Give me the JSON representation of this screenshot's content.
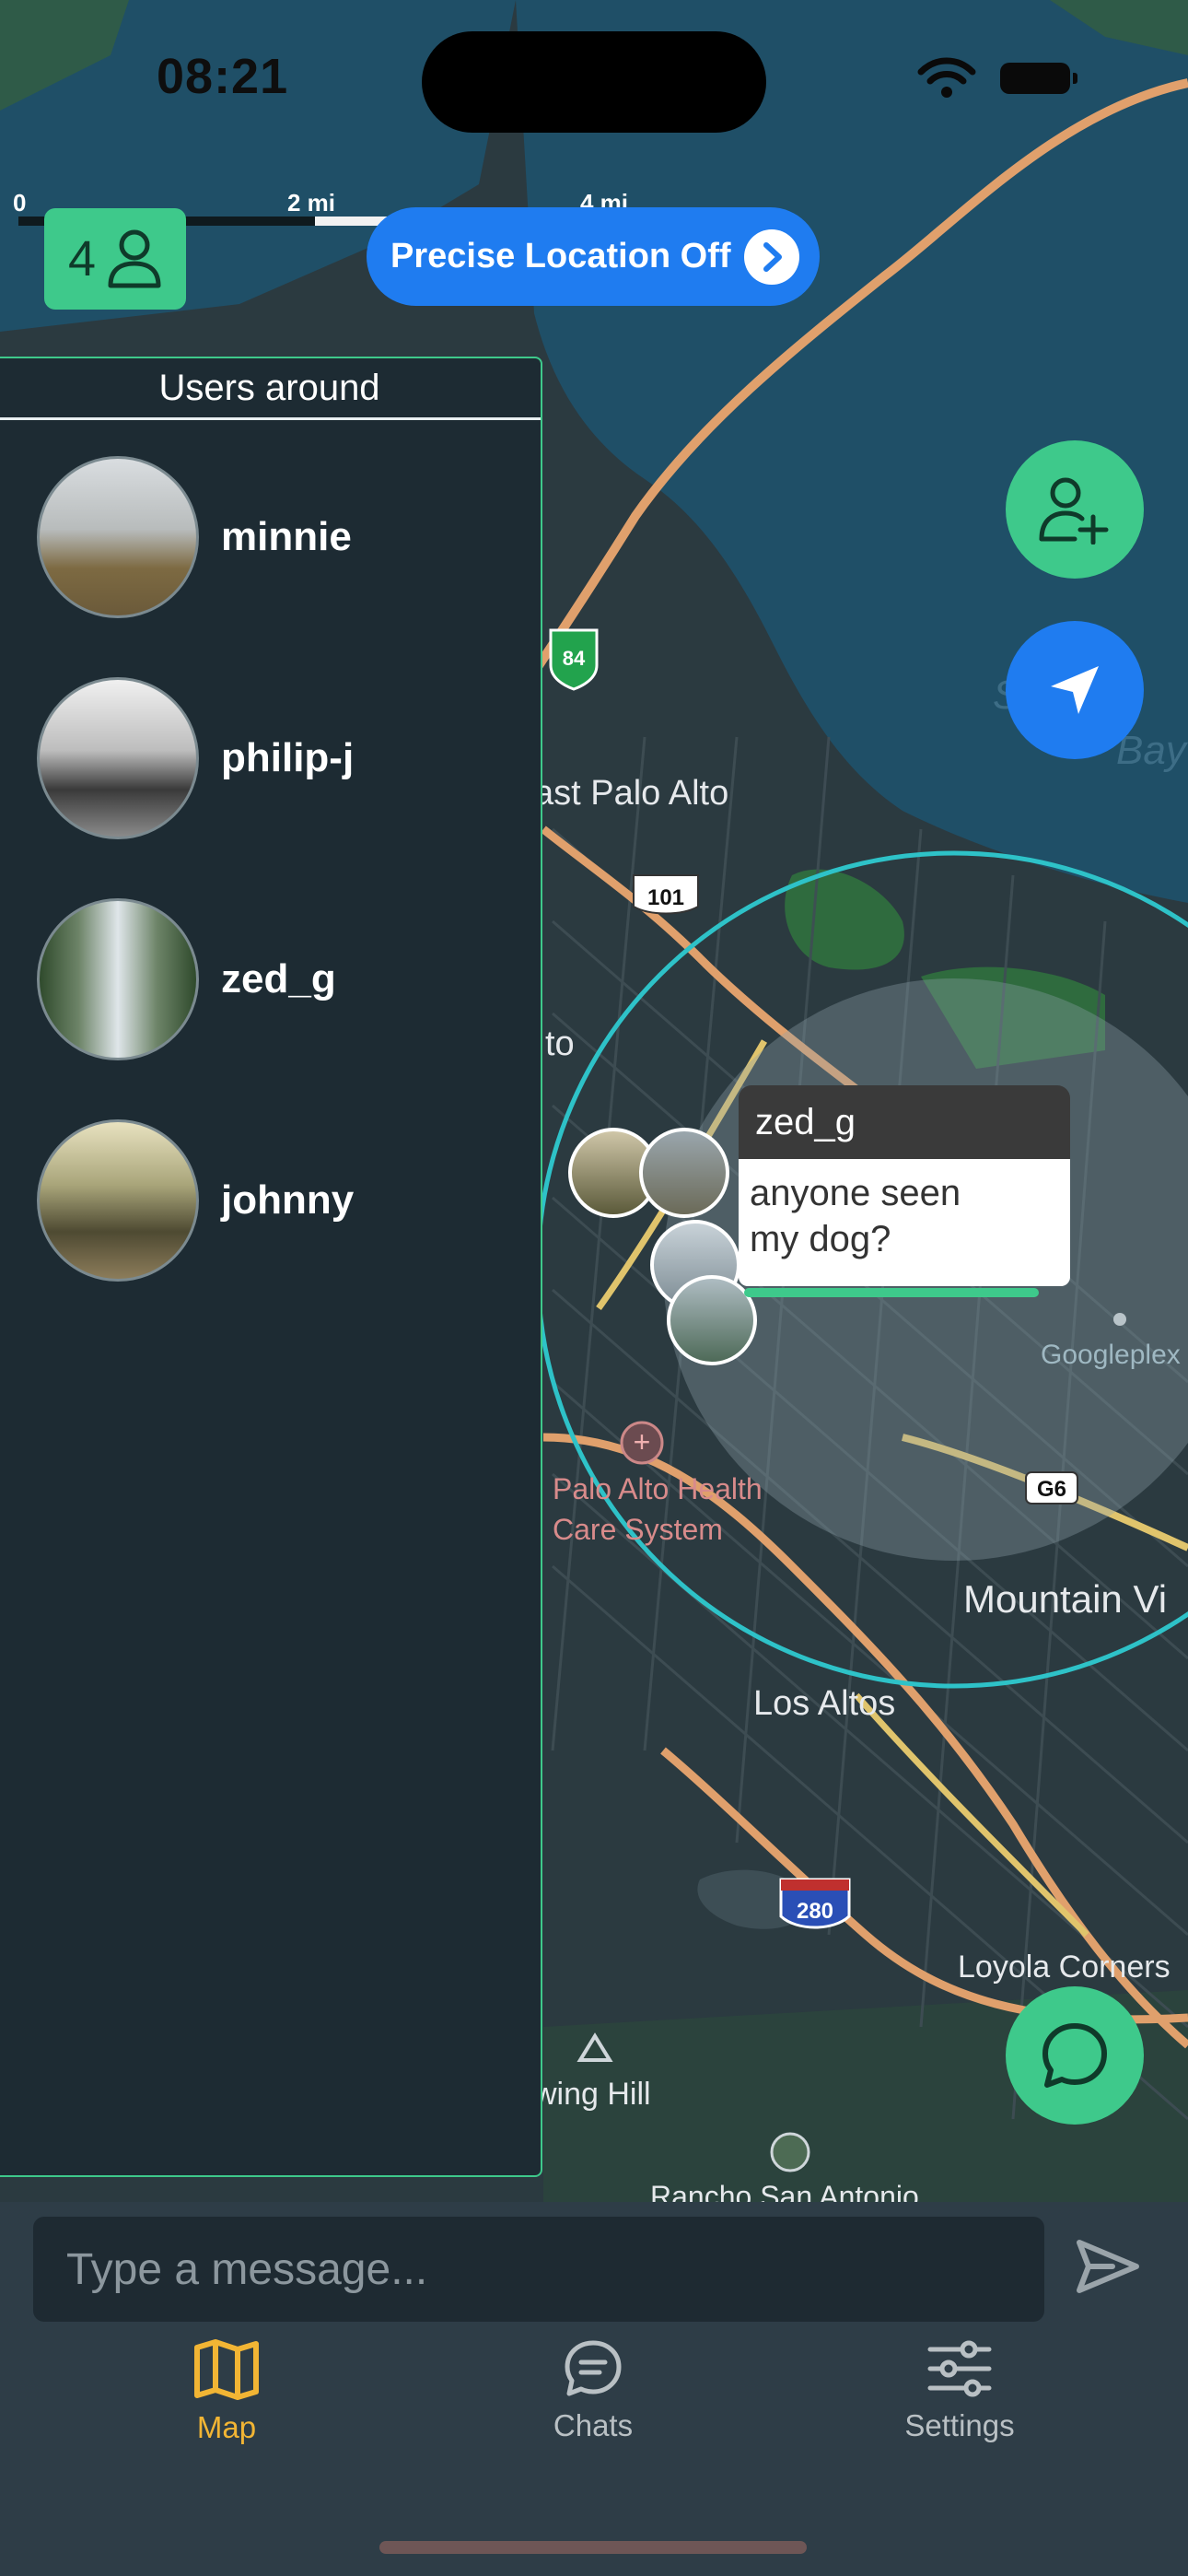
{
  "status_bar": {
    "time": "08:21"
  },
  "map": {
    "scale_labels": [
      "0",
      "2 mi",
      "4 mi"
    ],
    "place_labels": [
      "ast Palo Alto",
      "to",
      "Palo Alto Health",
      "Care System",
      "Mountain Vi",
      "Los Altos",
      "Loyola Corners",
      "Googleplex",
      "wing Hill",
      "Rancho San Antonio",
      "S",
      "Bay"
    ],
    "route_shields": [
      "84",
      "101",
      "280",
      "G6"
    ]
  },
  "user_count": {
    "count": "4",
    "icon": "person-icon"
  },
  "precise_location": {
    "label": "Precise Location Off",
    "icon": "chevron-right-icon"
  },
  "fabs": {
    "add_user": "person-plus-icon",
    "locate": "location-arrow-icon",
    "chat": "chat-bubble-icon"
  },
  "users_panel": {
    "title": "Users around",
    "users": [
      {
        "name": "minnie"
      },
      {
        "name": "philip-j"
      },
      {
        "name": "zed_g"
      },
      {
        "name": "johnny"
      }
    ]
  },
  "chat_bubble": {
    "sender": "zed_g",
    "message_line1": "anyone seen",
    "message_line2": "my dog?"
  },
  "composer": {
    "placeholder": "Type a message...",
    "send_icon": "send-icon"
  },
  "tabs": [
    {
      "label": "Map",
      "icon": "map-icon",
      "active": true
    },
    {
      "label": "Chats",
      "icon": "chat-icon",
      "active": false
    },
    {
      "label": "Settings",
      "icon": "sliders-icon",
      "active": false
    }
  ],
  "colors": {
    "accent_green": "#3ec98b",
    "accent_blue": "#1f7cf0",
    "active_tab": "#f2b534",
    "inactive_tab": "#b9c0c4"
  }
}
